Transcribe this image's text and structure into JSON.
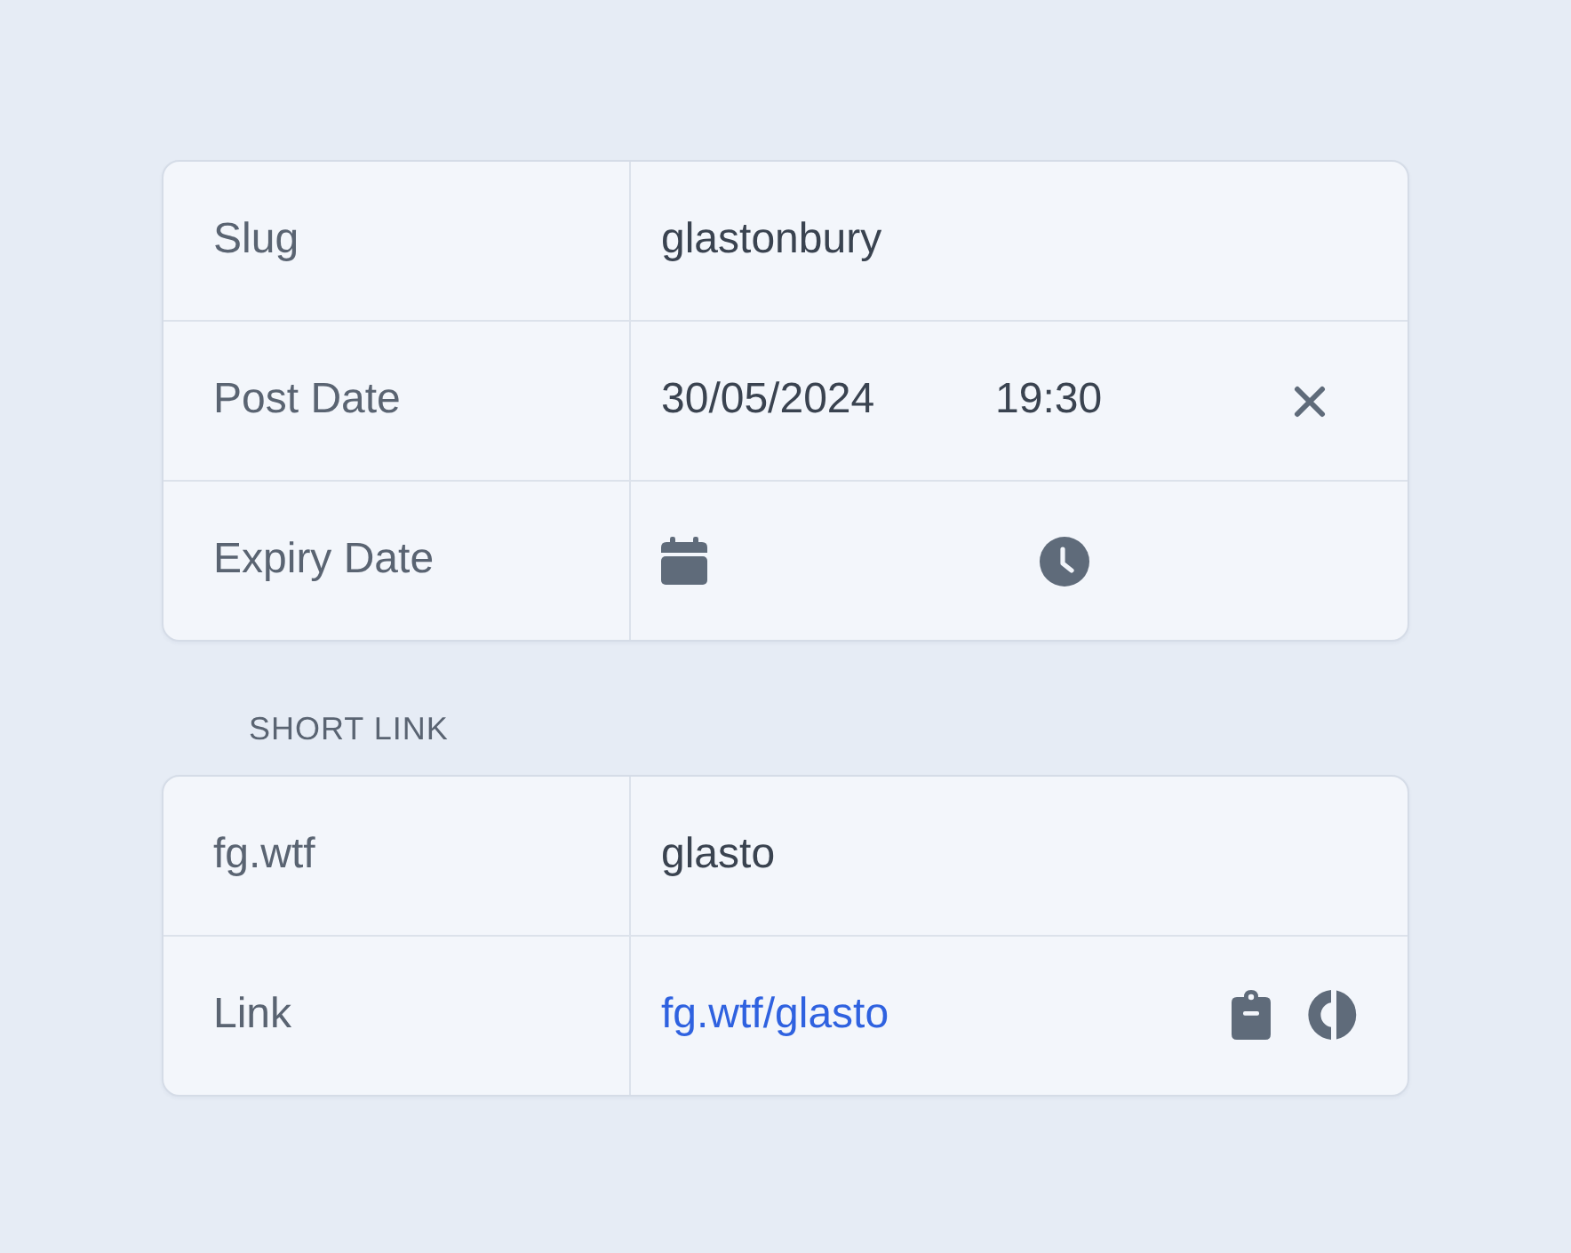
{
  "fields": [
    {
      "label": "Slug",
      "kind": "text",
      "value": "glastonbury"
    },
    {
      "label": "Post Date",
      "kind": "datetime",
      "date": "30/05/2024",
      "time": "19:30",
      "clearable": true
    },
    {
      "label": "Expiry Date",
      "kind": "datetime",
      "clearable": false
    }
  ],
  "short_link": {
    "heading": "SHORT LINK",
    "fields": [
      {
        "label": "fg.wtf",
        "kind": "text",
        "value": "glasto"
      },
      {
        "label": "Link",
        "kind": "link",
        "value": "fg.wtf/glasto"
      }
    ]
  }
}
